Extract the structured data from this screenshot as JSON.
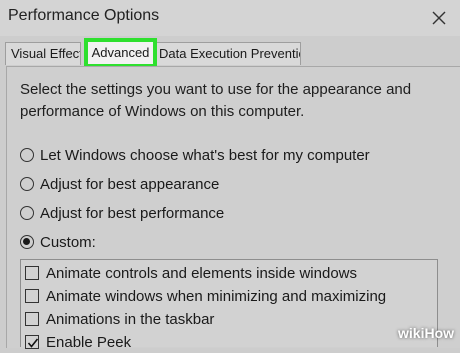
{
  "window": {
    "title": "Performance Options",
    "close_icon": "close-icon"
  },
  "tabs": [
    {
      "label": "Visual Effects",
      "selected": false
    },
    {
      "label": "Advanced",
      "selected": true,
      "highlight_color": "#2ee02e"
    },
    {
      "label": "Data Execution Prevention",
      "selected": false
    }
  ],
  "panel": {
    "description": "Select the settings you want to use for the appearance and performance of Windows on this computer.",
    "radio_options": [
      {
        "label": "Let Windows choose what's best for my computer",
        "checked": false
      },
      {
        "label": "Adjust for best appearance",
        "checked": false
      },
      {
        "label": "Adjust for best performance",
        "checked": false
      },
      {
        "label": "Custom:",
        "checked": true
      }
    ],
    "effects": [
      {
        "label": "Animate controls and elements inside windows",
        "checked": false
      },
      {
        "label": "Animate windows when minimizing and maximizing",
        "checked": false
      },
      {
        "label": "Animations in the taskbar",
        "checked": false
      },
      {
        "label": "Enable Peek",
        "checked": true
      }
    ]
  },
  "watermark": {
    "wiki": "wiki",
    "how": "How"
  }
}
